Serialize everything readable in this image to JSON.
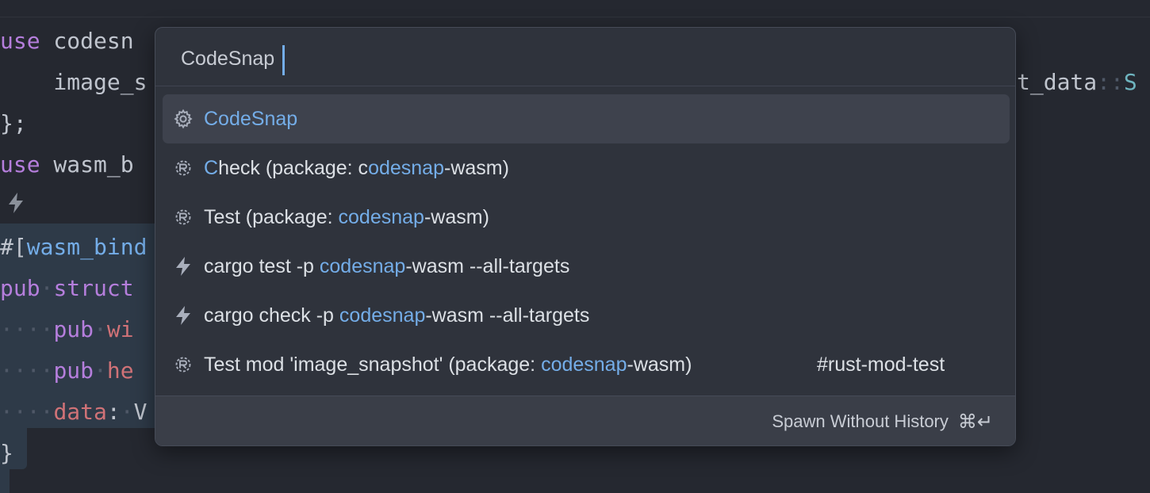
{
  "editor": {
    "lines": [
      {
        "id": "l1",
        "parts": [
          [
            "kw",
            "use"
          ],
          [
            "plain",
            " codesn"
          ]
        ]
      },
      {
        "id": "l2",
        "parts": [
          [
            "plain",
            "    image_s"
          ]
        ]
      },
      {
        "id": "l3",
        "parts": [
          [
            "plain",
            "};"
          ]
        ]
      },
      {
        "id": "l4",
        "parts": [
          [
            "kw",
            "use"
          ],
          [
            "plain",
            " wasm_b"
          ]
        ]
      },
      {
        "id": "l6",
        "parts": [
          [
            "plain",
            "#["
          ],
          [
            "fn",
            "wasm_bind"
          ]
        ]
      },
      {
        "id": "l7",
        "parts": [
          [
            "kw",
            "pub"
          ],
          [
            "ws",
            "·"
          ],
          [
            "kw",
            "struct"
          ]
        ]
      },
      {
        "id": "l8",
        "parts": [
          [
            "ws",
            "····"
          ],
          [
            "kw",
            "pub"
          ],
          [
            "ws",
            "·"
          ],
          [
            "fld",
            "wi"
          ]
        ]
      },
      {
        "id": "l9",
        "parts": [
          [
            "ws",
            "····"
          ],
          [
            "kw",
            "pub"
          ],
          [
            "ws",
            "·"
          ],
          [
            "fld",
            "he"
          ]
        ]
      },
      {
        "id": "l10",
        "parts": [
          [
            "ws",
            "····"
          ],
          [
            "fld",
            "data"
          ],
          [
            "plain",
            ":"
          ],
          [
            "ws",
            "·"
          ],
          [
            "plain",
            "V"
          ]
        ]
      },
      {
        "id": "l11",
        "parts": [
          [
            "plain",
            "}"
          ]
        ]
      }
    ],
    "right_fragment": [
      [
        "plain",
        "t_data"
      ],
      [
        "ws",
        "::"
      ],
      [
        "ty",
        "S"
      ]
    ]
  },
  "picker": {
    "query": "CodeSnap",
    "results": [
      {
        "icon": "gear-icon",
        "parts": [
          [
            "hl",
            "CodeSnap"
          ]
        ],
        "tag": ""
      },
      {
        "icon": "rust-icon",
        "parts": [
          [
            "hl",
            "C"
          ],
          [
            "plain",
            "heck (package: c"
          ],
          [
            "hl",
            "odesnap"
          ],
          [
            "plain",
            "-wasm)"
          ]
        ],
        "tag": ""
      },
      {
        "icon": "rust-icon",
        "parts": [
          [
            "plain",
            "Test (package: "
          ],
          [
            "hl",
            "codesnap"
          ],
          [
            "plain",
            "-wasm)"
          ]
        ],
        "tag": ""
      },
      {
        "icon": "bolt-icon",
        "parts": [
          [
            "plain",
            "cargo test -p "
          ],
          [
            "hl",
            "codesnap"
          ],
          [
            "plain",
            "-wasm --all-targets"
          ]
        ],
        "tag": ""
      },
      {
        "icon": "bolt-icon",
        "parts": [
          [
            "plain",
            "cargo check -p "
          ],
          [
            "hl",
            "codesnap"
          ],
          [
            "plain",
            "-wasm --all-targets"
          ]
        ],
        "tag": ""
      },
      {
        "icon": "rust-icon",
        "parts": [
          [
            "plain",
            "Test mod 'image_snapshot' (package: "
          ],
          [
            "hl",
            "codesnap"
          ],
          [
            "plain",
            "-wasm)"
          ]
        ],
        "tag": "#rust-mod-test"
      }
    ],
    "selected_index": 0,
    "footer": {
      "spawn_label": "Spawn Without History",
      "shortcut": "⌘↵"
    }
  },
  "colors": {
    "accent": "#74ade8",
    "background": "#252830",
    "picker_bg": "#2f333c",
    "selection_bg": "#3e424d"
  }
}
